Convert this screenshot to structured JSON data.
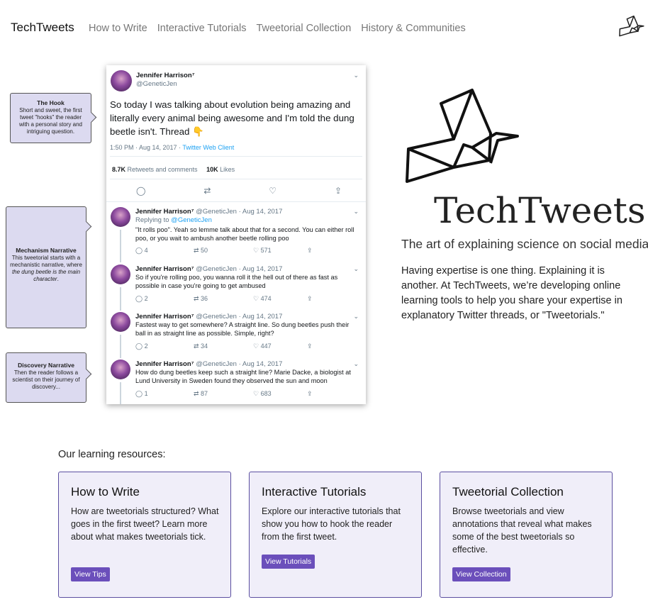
{
  "nav": {
    "brand": "TechTweets",
    "links": [
      "How to Write",
      "Interactive Tutorials",
      "Tweetorial Collection",
      "History & Communities"
    ]
  },
  "colors": {
    "accent": "#6b4fbb",
    "card_bg": "#f0eef9",
    "card_border": "#5b4fa0",
    "callout_bg": "#dcdaf0",
    "link_blue": "#1da1f2"
  },
  "callouts": [
    {
      "title": "The Hook",
      "text": "Short and sweet, the first tweet \"hooks\" the reader with a personal story and intriguing question."
    },
    {
      "title": "Mechanism Narrative",
      "text_a": "This tweetorial starts with a mechanistic narrative, where ",
      "text_em": "the dung beetle is the main character",
      "text_b": "."
    },
    {
      "title": "Discovery Narrative",
      "text": "Then the reader follows a scientist on their journey of discovery..."
    }
  ],
  "tweet_main": {
    "name": "Jennifer Harrison⁷",
    "handle": "@GeneticJen",
    "text": "So today I was talking about evolution being amazing and literally every animal being awesome and I'm told the dung beetle isn't. Thread 👇",
    "time": "1:50 PM · Aug 14, 2017 · ",
    "client": "Twitter Web Client",
    "retweets_count": "8.7K",
    "retweets_label": " Retweets and comments",
    "likes_count": "10K",
    "likes_label": " Likes"
  },
  "replies": [
    {
      "name": "Jennifer Harrison⁷",
      "meta": "@GeneticJen · Aug 14, 2017",
      "replying_label": "Replying to ",
      "replying_to": "@GeneticJen",
      "text": "\"It rolls poo\". Yeah so lemme talk about that for a second. You can either roll poo, or you wait to ambush another beetle rolling poo",
      "comments": "4",
      "retweets": "50",
      "likes": "571"
    },
    {
      "name": "Jennifer Harrison⁷",
      "meta": "@GeneticJen · Aug 14, 2017",
      "text": "So if you're rolling poo, you wanna roll it the hell out of there as fast as possible in case you're going to get ambused",
      "comments": "2",
      "retweets": "36",
      "likes": "474"
    },
    {
      "name": "Jennifer Harrison⁷",
      "meta": "@GeneticJen · Aug 14, 2017",
      "text": "Fastest way to get somewhere? A straight line. So dung beetles push their ball in as straight line as possible. Simple, right?",
      "comments": "2",
      "retweets": "34",
      "likes": "447"
    },
    {
      "name": "Jennifer Harrison⁷",
      "meta": "@GeneticJen · Aug 14, 2017",
      "text": "How do dung beetles keep such a straight line? Marie Dacke, a biologist at Lund University in Sweden found they observed the sun and moon",
      "comments": "1",
      "retweets": "87",
      "likes": "683"
    }
  ],
  "hero": {
    "title": "TechTweets",
    "subtitle": "The art of explaining science on social media",
    "description": "Having expertise is one thing. Explaining it is another. At TechTweets, we’re developing online learning tools to help you share your expertise in explanatory Twitter threads, or \"Tweetorials.\""
  },
  "resources": {
    "heading": "Our learning resources:",
    "cards": [
      {
        "title": "How to Write",
        "text": "How are tweetorials structured? What goes in the first tweet? Learn more about what makes tweetorials tick.",
        "button": "View Tips"
      },
      {
        "title": "Interactive Tutorials",
        "text": "Explore our interactive tutorials that show you how to hook the reader from the first tweet.",
        "button": "View Tutorials"
      },
      {
        "title": "Tweetorial Collection",
        "text": "Browse tweetorials and view annotations that reveal what makes some of the best tweetorials so effective.",
        "button": "View Collection"
      }
    ]
  }
}
